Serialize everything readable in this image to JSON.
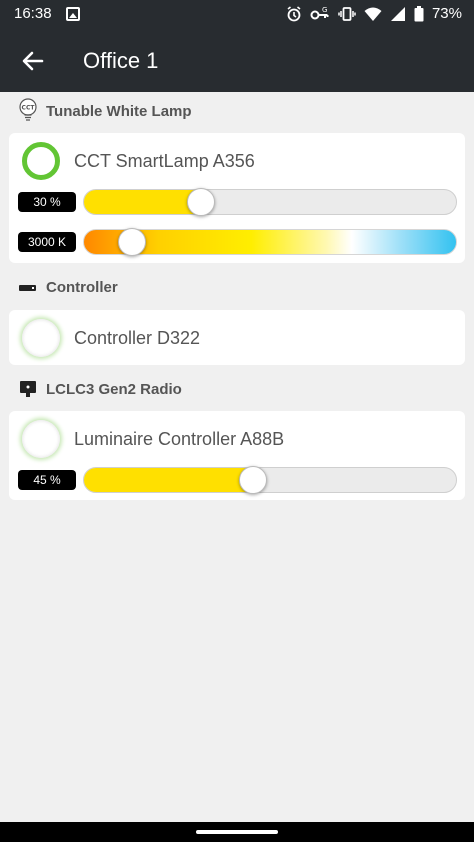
{
  "status_bar": {
    "time": "16:38",
    "battery": "73%"
  },
  "app_bar": {
    "title": "Office 1"
  },
  "sections": [
    {
      "title": "Tunable White Lamp",
      "icon": "cct-bulb-icon"
    },
    {
      "title": "Controller",
      "icon": "controller-icon"
    },
    {
      "title": "LCLC3 Gen2 Radio",
      "icon": "radio-icon"
    }
  ],
  "devices": [
    {
      "name": "CCT SmartLamp A356",
      "state": "on",
      "brightness_label": "30 %",
      "brightness": 0.3,
      "cct_label": "3000 K",
      "cct_position": 0.1
    },
    {
      "name": "Controller D322",
      "state": "off"
    },
    {
      "name": "Luminaire Controller A88B",
      "state": "off",
      "brightness_label": "45 %",
      "brightness": 0.45
    }
  ],
  "colors": {
    "app_bar": "#282c30",
    "on_ring": "#62c534",
    "fill": "#ffe000",
    "background": "#f0f0f0"
  }
}
